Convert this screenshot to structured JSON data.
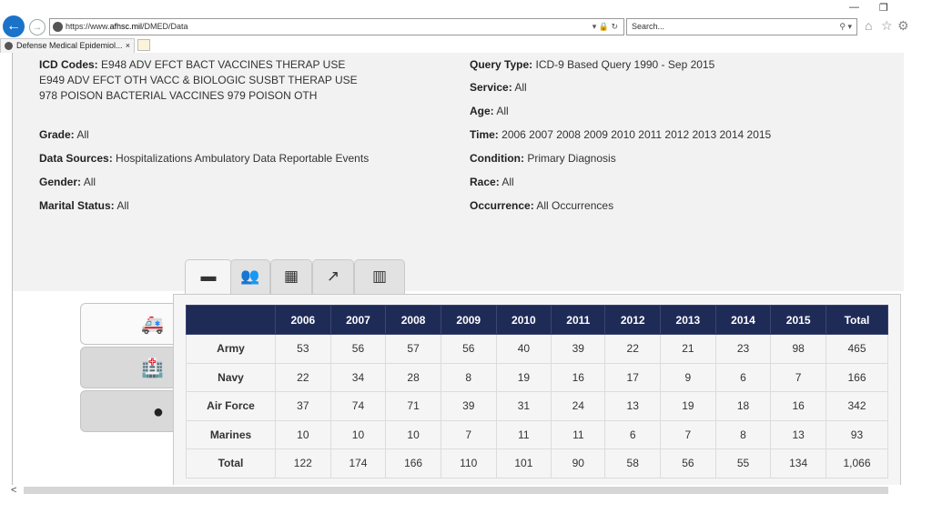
{
  "browser": {
    "url_prefix": "https://www.",
    "url_host": "afhsc.mil",
    "url_path": "/DMED/Data",
    "search_placeholder": "Search...",
    "tab_title": "Defense Medical Epidemiol...",
    "tab_close": "×"
  },
  "info": {
    "icd_label": "ICD Codes:",
    "icd_line1": "E948 ADV EFCT BACT VACCINES THERAP USE",
    "icd_line2": "E949 ADV EFCT OTH VACC & BIOLOGIC SUSBT THERAP USE",
    "icd_line3": "978 POISON BACTERIAL VACCINES 979 POISON OTH",
    "grade_label": "Grade:",
    "grade": "All",
    "sources_label": "Data Sources:",
    "sources": "Hospitalizations Ambulatory Data Reportable Events",
    "gender_label": "Gender:",
    "gender": "All",
    "marital_label": "Marital Status:",
    "marital": "All",
    "query_label": "Query Type:",
    "query": "ICD-9 Based Query 1990 - Sep 2015",
    "service_label": "Service:",
    "service": "All",
    "age_label": "Age:",
    "age": "All",
    "time_label": "Time:",
    "time": "2006 2007 2008 2009 2010 2011 2012 2013 2014 2015",
    "condition_label": "Condition:",
    "condition": "Primary Diagnosis",
    "race_label": "Race:",
    "race": "All",
    "occurrence_label": "Occurrence:",
    "occurrence": "All Occurrences"
  },
  "table": {
    "headers": [
      "2006",
      "2007",
      "2008",
      "2009",
      "2010",
      "2011",
      "2012",
      "2013",
      "2014",
      "2015",
      "Total"
    ],
    "rows": [
      {
        "label": "Army",
        "values": [
          "53",
          "56",
          "57",
          "56",
          "40",
          "39",
          "22",
          "21",
          "23",
          "98",
          "465"
        ]
      },
      {
        "label": "Navy",
        "values": [
          "22",
          "34",
          "28",
          "8",
          "19",
          "16",
          "17",
          "9",
          "6",
          "7",
          "166"
        ]
      },
      {
        "label": "Air Force",
        "values": [
          "37",
          "74",
          "71",
          "39",
          "31",
          "24",
          "13",
          "19",
          "18",
          "16",
          "342"
        ]
      },
      {
        "label": "Marines",
        "values": [
          "10",
          "10",
          "10",
          "7",
          "11",
          "11",
          "6",
          "7",
          "8",
          "13",
          "93"
        ]
      },
      {
        "label": "Total",
        "values": [
          "122",
          "174",
          "166",
          "110",
          "101",
          "90",
          "58",
          "56",
          "55",
          "134",
          "1,066"
        ]
      }
    ]
  },
  "icons": {
    "top_tabs": [
      "archive-icon",
      "group-icon",
      "table-icon",
      "line-chart-icon",
      "bar-chart-icon"
    ],
    "side_tabs": [
      "ambulance-icon",
      "hospital-icon",
      "map-pin-icon"
    ]
  },
  "colors": {
    "header_bg": "#1f2b57",
    "back_button": "#1a73c9"
  }
}
